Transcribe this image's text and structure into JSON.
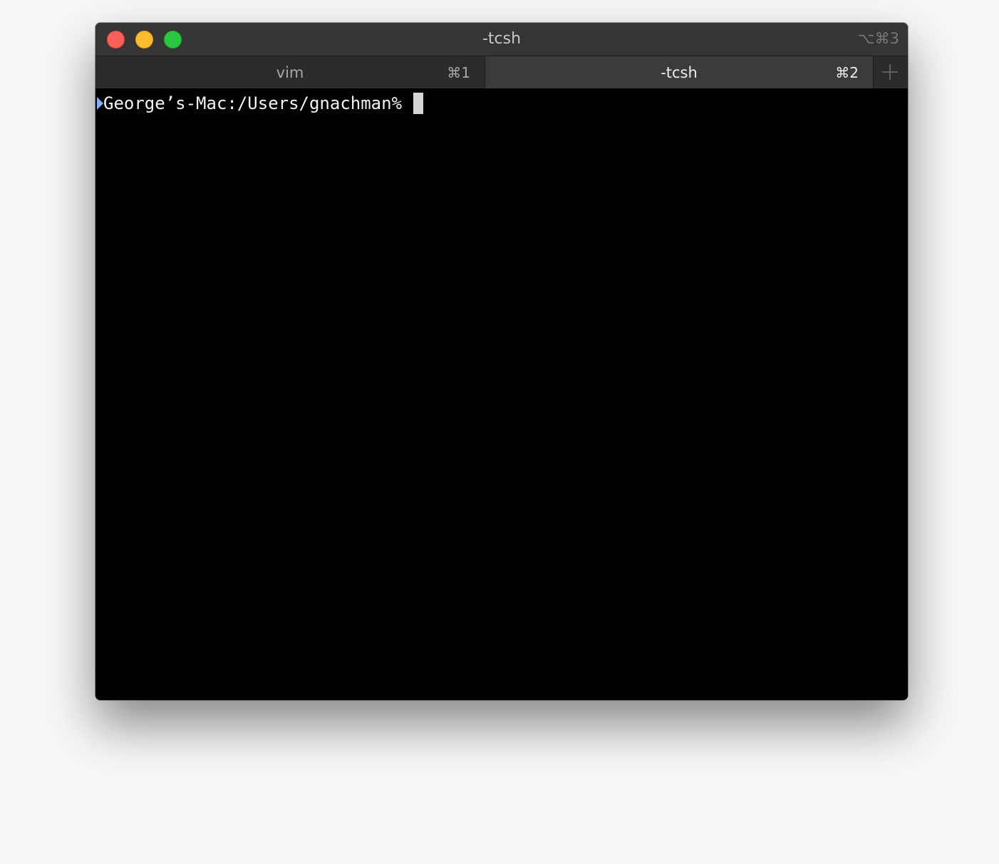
{
  "window": {
    "title": "-tcsh",
    "shortcut": "⌥⌘3"
  },
  "tabs": [
    {
      "label": "vim",
      "shortcut": "⌘1",
      "active": false
    },
    {
      "label": "-tcsh",
      "shortcut": "⌘2",
      "active": true
    }
  ],
  "new_tab_icon": "plus-icon",
  "terminal": {
    "prompt": "George’s-Mac:/Users/gnachman% ",
    "mark_color": "#7ab4ff"
  },
  "colors": {
    "close": "#fc5f57",
    "minimize": "#fdbb2d",
    "zoom": "#28c840"
  }
}
